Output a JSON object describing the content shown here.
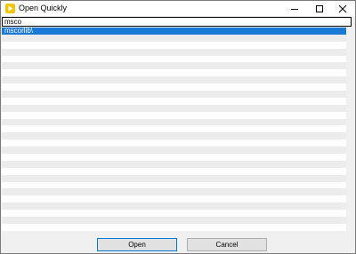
{
  "window": {
    "title": "Open Quickly",
    "icon": "app-play-icon",
    "controls": [
      "minimize-icon",
      "maximize-icon",
      "close-icon"
    ]
  },
  "search": {
    "value": "msco",
    "placeholder": ""
  },
  "results": {
    "selected_index": 0,
    "items": [
      "mscorlib\\"
    ],
    "empty_rows": 28
  },
  "footer": {
    "open_label": "Open",
    "cancel_label": "Cancel"
  },
  "colors": {
    "selection": "#1a78d6",
    "alt_row": "#ececec",
    "primary_border": "#0078d7"
  }
}
